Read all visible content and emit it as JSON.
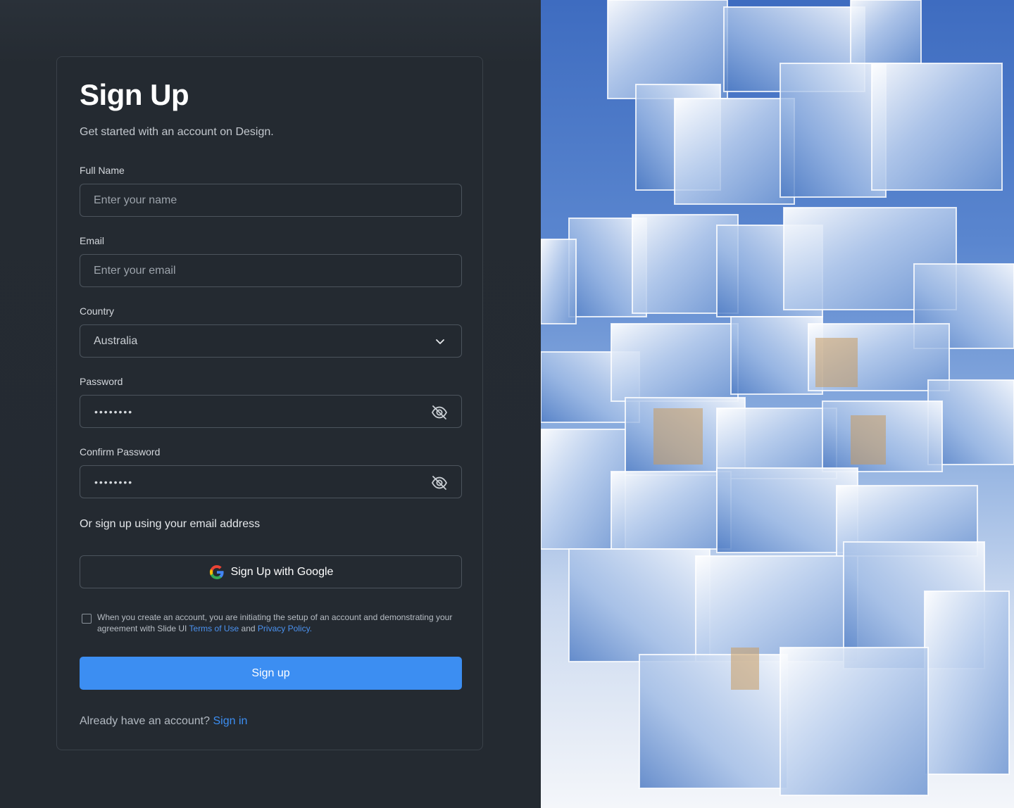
{
  "form": {
    "title": "Sign Up",
    "subtitle": "Get started with an account on Design.",
    "full_name": {
      "label": "Full Name",
      "placeholder": "Enter your name"
    },
    "email": {
      "label": "Email",
      "placeholder": "Enter your email"
    },
    "country": {
      "label": "Country",
      "value": "Australia"
    },
    "password": {
      "label": "Password",
      "masked": "••••••••"
    },
    "confirm_password": {
      "label": "Confirm Password",
      "masked": "••••••••"
    },
    "or_text": "Or sign up using your email address",
    "google_button": "Sign Up with Google",
    "terms": {
      "text_1": "When you create an account, you are initiating the setup of an account and demonstrating your agreement with Slide UI ",
      "terms_link": "Terms of Use",
      "text_2": " and ",
      "privacy_link": "Privacy Policy.",
      "checked": false
    },
    "submit_button": "Sign up",
    "footer": {
      "text": "Already have an account? ",
      "link": "Sign in"
    }
  },
  "colors": {
    "accent": "#3c8ef2",
    "background": "#252b32",
    "field_border": "#4c545d"
  },
  "icons": {
    "country_dropdown": "chevron-down-icon",
    "password_toggle": "eye-off-icon",
    "google": "google-logo-icon"
  },
  "hero_image": {
    "description": "glass cubes architectural render"
  }
}
